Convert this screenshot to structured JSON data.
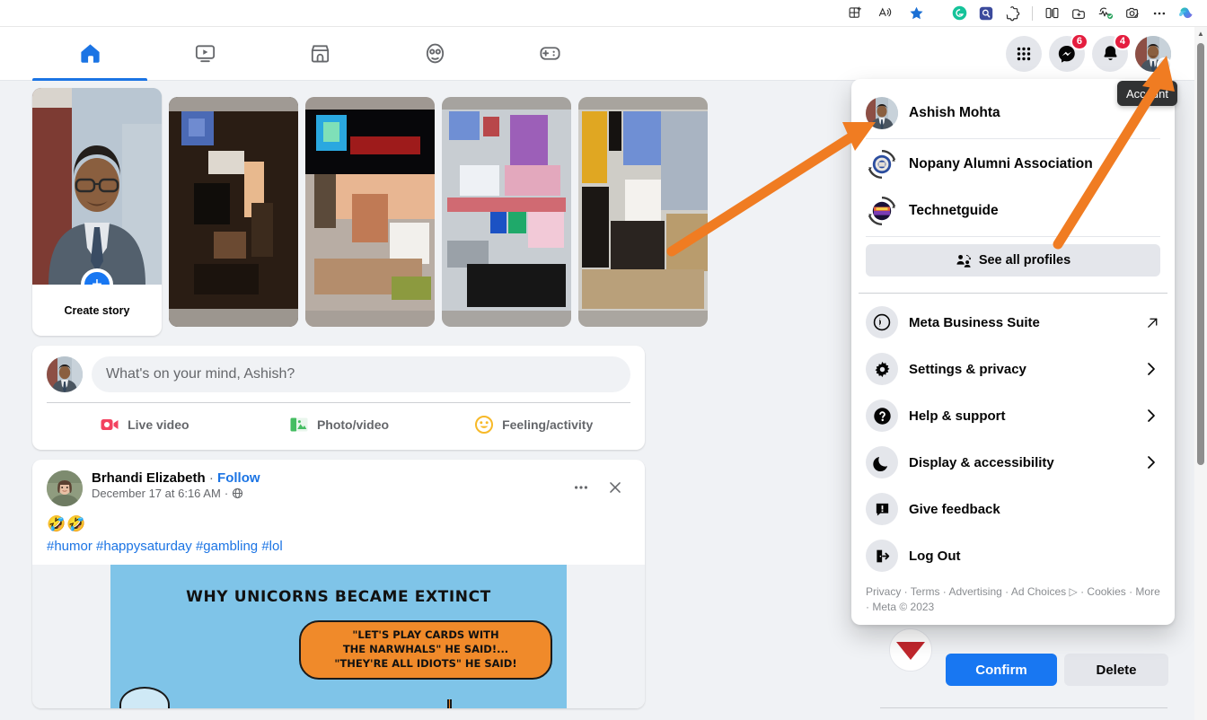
{
  "browser": {
    "toolbar_icons": [
      {
        "name": "collections-add-icon",
        "glyph": "collections"
      },
      {
        "name": "read-aloud-icon",
        "glyph": "read-aloud"
      },
      {
        "name": "favorites-star-icon",
        "glyph": "star"
      },
      {
        "name": "grammarly-extension-icon",
        "glyph": "G"
      },
      {
        "name": "extension-blue-icon",
        "glyph": "ext-blue"
      },
      {
        "name": "extensions-puzzle-icon",
        "glyph": "puzzle"
      },
      {
        "name": "split-screen-icon",
        "glyph": "split"
      },
      {
        "name": "add-tab-to-collection-icon",
        "glyph": "tab-add"
      },
      {
        "name": "browser-essentials-icon",
        "glyph": "essentials"
      },
      {
        "name": "screenshot-icon",
        "glyph": "screenshot"
      },
      {
        "name": "settings-more-icon",
        "glyph": "ellipsis"
      },
      {
        "name": "copilot-icon",
        "glyph": "copilot"
      }
    ]
  },
  "topnav": {
    "tabs": [
      {
        "name": "tab-home",
        "icon": "home-icon",
        "active": true
      },
      {
        "name": "tab-video",
        "icon": "video-icon",
        "active": false
      },
      {
        "name": "tab-marketplace",
        "icon": "marketplace-icon",
        "active": false
      },
      {
        "name": "tab-groups",
        "icon": "groups-icon",
        "active": false
      },
      {
        "name": "tab-gaming",
        "icon": "gaming-icon",
        "active": false
      }
    ],
    "menu_grid_label": "Menu",
    "messenger_badge": "6",
    "notifications_badge": "4",
    "account_tooltip": "Account"
  },
  "stories": {
    "create_story_label": "Create story",
    "create_story_plus": "+",
    "cards": [
      {
        "name": "story-card-1"
      },
      {
        "name": "story-card-2"
      },
      {
        "name": "story-card-3"
      },
      {
        "name": "story-card-4"
      }
    ]
  },
  "composer": {
    "placeholder": "What's on your mind, Ashish?",
    "actions": [
      {
        "name": "live-video-button",
        "label": "Live video",
        "icon": "live-video-icon",
        "color": "#f3425f"
      },
      {
        "name": "photo-video-button",
        "label": "Photo/video",
        "icon": "photo-icon",
        "color": "#45bd62"
      },
      {
        "name": "feeling-activity-button",
        "label": "Feeling/activity",
        "icon": "emoji-icon",
        "color": "#f7b928"
      }
    ]
  },
  "post": {
    "author": "Brhandi Elizabeth",
    "separator": "·",
    "follow_label": "Follow",
    "timestamp": "December 17 at 6:16 AM",
    "privacy_icon": "globe-icon",
    "body_emoji": "🤣🤣",
    "hashtags": "#humor #happysaturday #gambling #lol",
    "more_options": "···",
    "close": "✕",
    "image": {
      "title": "WHY UNICORNS BECAME EXTINCT",
      "bubble_line1": "\"LET'S PLAY CARDS WITH",
      "bubble_line2": "THE NARWHALS\" HE SAID!...",
      "bubble_line3": "\"THEY'RE ALL IDIOTS\" HE SAID!"
    }
  },
  "account_menu": {
    "profiles": [
      {
        "name": "profile-ashish-mohta",
        "label": "Ashish Mohta",
        "avatar": "user-photo"
      },
      {
        "name": "profile-nopany-alumni",
        "label": "Nopany Alumni Association",
        "avatar": "page-logo"
      },
      {
        "name": "profile-technetguide",
        "label": "Technetguide",
        "avatar": "page-logo"
      }
    ],
    "see_all_profiles": "See all profiles",
    "see_all_icon": "switch-profile-icon",
    "items": [
      {
        "name": "menu-meta-business-suite",
        "label": "Meta Business Suite",
        "icon": "meta-icon",
        "right": "external-link-icon"
      },
      {
        "name": "menu-settings-privacy",
        "label": "Settings & privacy",
        "icon": "gear-icon",
        "right": "chevron-right-icon"
      },
      {
        "name": "menu-help-support",
        "label": "Help & support",
        "icon": "question-icon",
        "right": "chevron-right-icon"
      },
      {
        "name": "menu-display-accessibility",
        "label": "Display & accessibility",
        "icon": "moon-icon",
        "right": "chevron-right-icon"
      },
      {
        "name": "menu-give-feedback",
        "label": "Give feedback",
        "icon": "feedback-icon",
        "right": ""
      },
      {
        "name": "menu-log-out",
        "label": "Log Out",
        "icon": "logout-icon",
        "right": ""
      }
    ],
    "footer": "Privacy · Terms · Advertising · Ad Choices ▷ · Cookies · More · Meta © 2023"
  },
  "background_dialog": {
    "confirm_label": "Confirm",
    "delete_label": "Delete"
  },
  "annotations": {
    "arrow_color": "#f07c22"
  },
  "colors": {
    "fb_blue": "#1877f2",
    "link_blue": "#1b74e4",
    "page_bg": "#f0f2f5",
    "badge_red": "#e41e3f",
    "arrow_orange": "#f07c22"
  }
}
